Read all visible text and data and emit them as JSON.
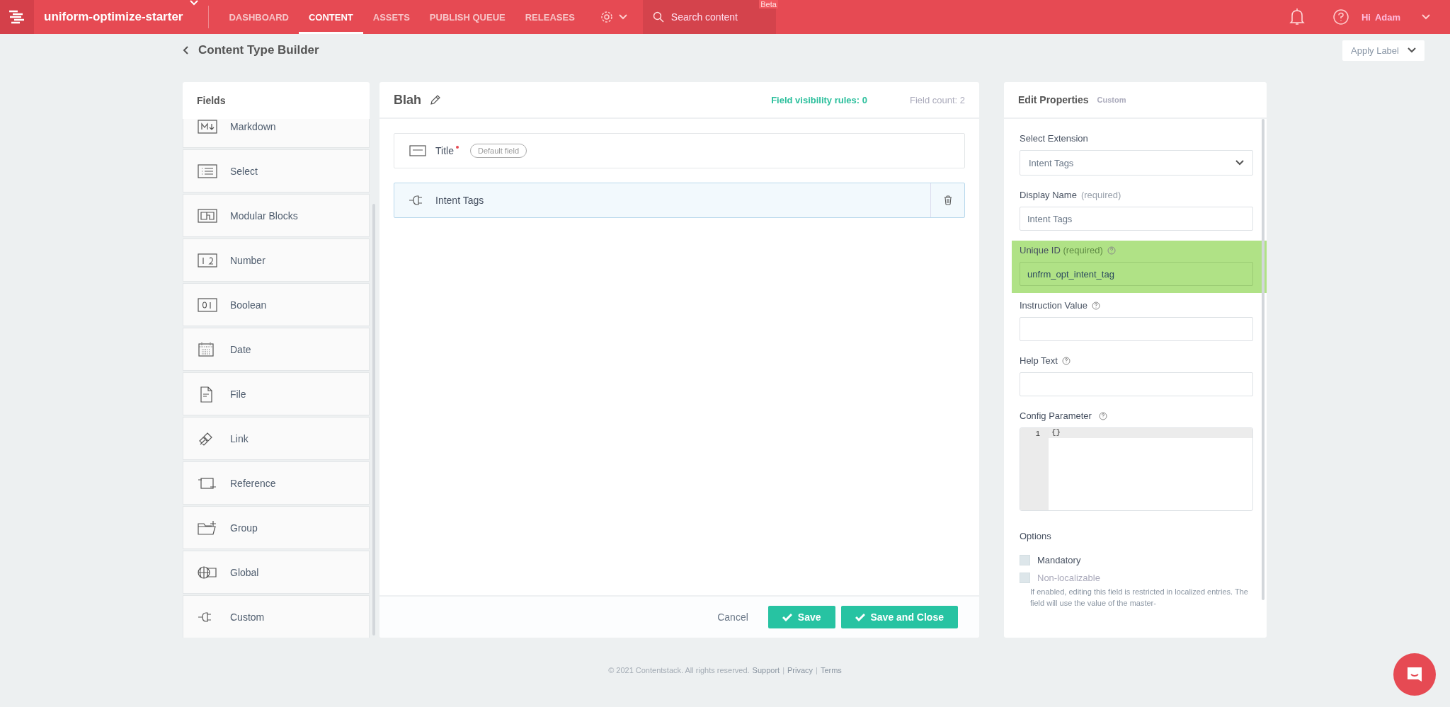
{
  "top_bar": {
    "app_name": "uniform-optimize-starter",
    "menu": [
      {
        "label": "DASHBOARD",
        "selected": false
      },
      {
        "label": "CONTENT",
        "selected": true
      },
      {
        "label": "ASSETS",
        "selected": false
      },
      {
        "label": "PUBLISH QUEUE",
        "selected": false
      },
      {
        "label": "RELEASES",
        "selected": false
      }
    ],
    "search": {
      "placeholder": "Search content",
      "badge": "Beta"
    },
    "greeting": "Hi",
    "user": "Adam"
  },
  "header": {
    "title": "Content Type Builder",
    "apply_label": "Apply Label"
  },
  "fields_panel": {
    "title": "Fields",
    "items": [
      {
        "label": "Markdown",
        "kind": "markdown"
      },
      {
        "label": "Select",
        "kind": "select"
      },
      {
        "label": "Modular Blocks",
        "kind": "blocks"
      },
      {
        "label": "Number",
        "kind": "number"
      },
      {
        "label": "Boolean",
        "kind": "boolean"
      },
      {
        "label": "Date",
        "kind": "date"
      },
      {
        "label": "File",
        "kind": "file"
      },
      {
        "label": "Link",
        "kind": "link"
      },
      {
        "label": "Reference",
        "kind": "reference"
      },
      {
        "label": "Group",
        "kind": "group"
      },
      {
        "label": "Global",
        "kind": "global"
      },
      {
        "label": "Custom",
        "kind": "custom"
      }
    ]
  },
  "builder": {
    "title": "Blah",
    "visibility": "Field visibility rules: 0",
    "count": "Field count: 2",
    "rows": [
      {
        "label": "Title",
        "kind": "text",
        "required": true,
        "badge": "Default field",
        "selected": false
      },
      {
        "label": "Intent Tags",
        "kind": "custom",
        "required": false,
        "selected": true
      }
    ],
    "cancel": "Cancel",
    "save": "Save",
    "save_close": "Save and Close"
  },
  "properties": {
    "title": "Edit Properties",
    "subtitle": "Custom",
    "select_extension": {
      "label": "Select Extension",
      "value": "Intent Tags"
    },
    "display_name": {
      "label": "Display Name",
      "note": "(required)",
      "value": "Intent Tags"
    },
    "unique_id": {
      "label": "Unique ID",
      "note": "(required)",
      "value": "unfrm_opt_intent_tag",
      "highlighted": true
    },
    "instruction_value": {
      "label": "Instruction Value"
    },
    "help_text": {
      "label": "Help Text"
    },
    "config_parameter": {
      "label": "Config Parameter",
      "line": "1",
      "code": "{}"
    },
    "options": {
      "label": "Options",
      "items": [
        {
          "label": "Mandatory",
          "checked": false,
          "disabled": false
        },
        {
          "label": "Non-localizable",
          "checked": false,
          "disabled": true,
          "description": "If enabled, editing this field is restricted in localized entries. The field will use the value of the master-"
        }
      ]
    }
  },
  "footer": [
    {
      "kind": "text",
      "text": "© 2021 Contentstack. All rights reserved."
    },
    {
      "kind": "link",
      "text": "Support"
    },
    {
      "kind": "sep",
      "text": "|"
    },
    {
      "kind": "link",
      "text": "Privacy"
    },
    {
      "kind": "sep",
      "text": "|"
    },
    {
      "kind": "link",
      "text": "Terms"
    }
  ]
}
